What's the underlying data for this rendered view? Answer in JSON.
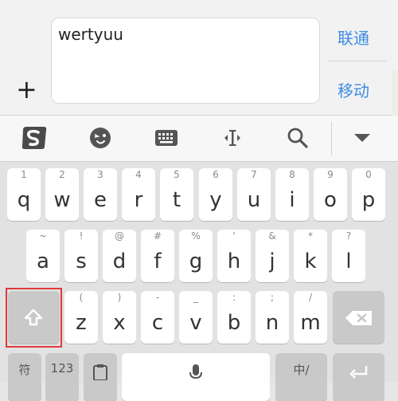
{
  "compose": {
    "text_value": "wertyuu",
    "contacts_link": "联通",
    "move_link": "移动"
  },
  "toolbar": {
    "icons": [
      "sogou-logo-icon",
      "emoji-icon",
      "keyboard-icon",
      "cursor-move-icon",
      "search-icon",
      "collapse-icon"
    ]
  },
  "keyboard": {
    "row1": [
      {
        "hint": "1",
        "letter": "q"
      },
      {
        "hint": "2",
        "letter": "w"
      },
      {
        "hint": "3",
        "letter": "e"
      },
      {
        "hint": "4",
        "letter": "r"
      },
      {
        "hint": "5",
        "letter": "t"
      },
      {
        "hint": "6",
        "letter": "y"
      },
      {
        "hint": "7",
        "letter": "u"
      },
      {
        "hint": "8",
        "letter": "i"
      },
      {
        "hint": "9",
        "letter": "o"
      },
      {
        "hint": "0",
        "letter": "p"
      }
    ],
    "row2": [
      {
        "hint": "~",
        "letter": "a"
      },
      {
        "hint": "!",
        "letter": "s"
      },
      {
        "hint": "@",
        "letter": "d"
      },
      {
        "hint": "#",
        "letter": "f"
      },
      {
        "hint": "%",
        "letter": "g"
      },
      {
        "hint": "'",
        "letter": "h"
      },
      {
        "hint": "&",
        "letter": "j"
      },
      {
        "hint": "*",
        "letter": "k"
      },
      {
        "hint": "?",
        "letter": "l"
      }
    ],
    "row3": [
      {
        "hint": "(",
        "letter": "z"
      },
      {
        "hint": ")",
        "letter": "x"
      },
      {
        "hint": "-",
        "letter": "c"
      },
      {
        "hint": "_",
        "letter": "v"
      },
      {
        "hint": ":",
        "letter": "b"
      },
      {
        "hint": ";",
        "letter": "n"
      },
      {
        "hint": "/",
        "letter": "m"
      }
    ],
    "bottom": {
      "symbol_label": "符",
      "number_label": "123",
      "lang_label": "中/"
    }
  }
}
